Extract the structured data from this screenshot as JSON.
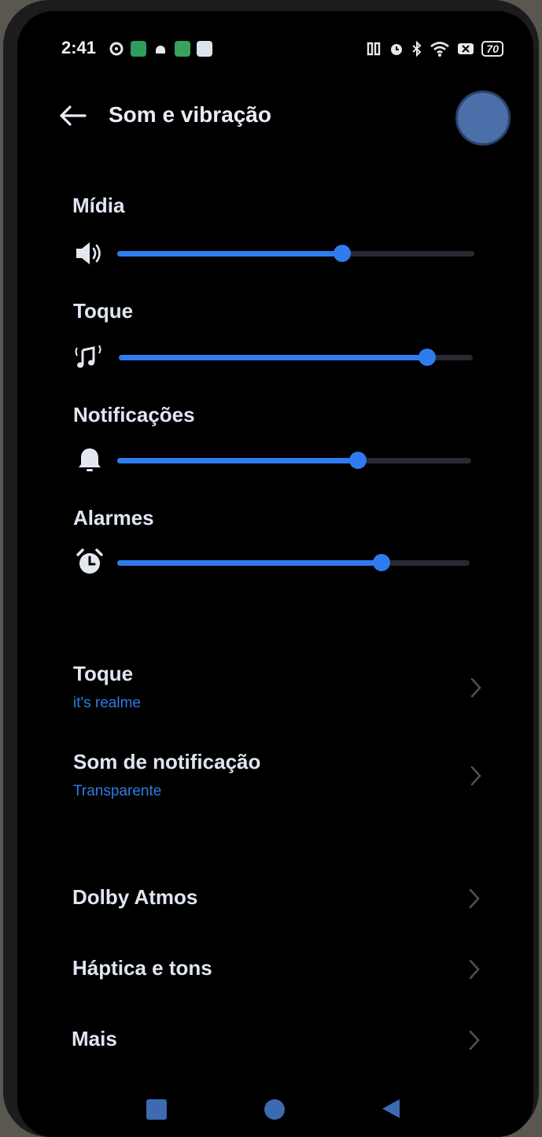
{
  "status_bar": {
    "time": "2:41",
    "battery": "70"
  },
  "header": {
    "title": "Som e vibração"
  },
  "sliders": [
    {
      "label": "Mídia",
      "icon": "speaker-icon",
      "level": 0.63
    },
    {
      "label": "Toque",
      "icon": "ringtone-icon",
      "level": 0.87
    },
    {
      "label": "Notificações",
      "icon": "bell-icon",
      "level": 0.68
    },
    {
      "label": "Alarmes",
      "icon": "alarm-clock-icon",
      "level": 0.75
    }
  ],
  "settings": [
    {
      "title": "Toque",
      "subtitle": "it's realme"
    },
    {
      "title": "Som de notificação",
      "subtitle": "Transparente"
    },
    {
      "title": "Dolby Atmos"
    },
    {
      "title": "Háptica e tons"
    },
    {
      "title": "Mais"
    }
  ],
  "colors": {
    "accent": "#2f7cf0",
    "background": "#000000",
    "text": "#dfe6f2"
  }
}
